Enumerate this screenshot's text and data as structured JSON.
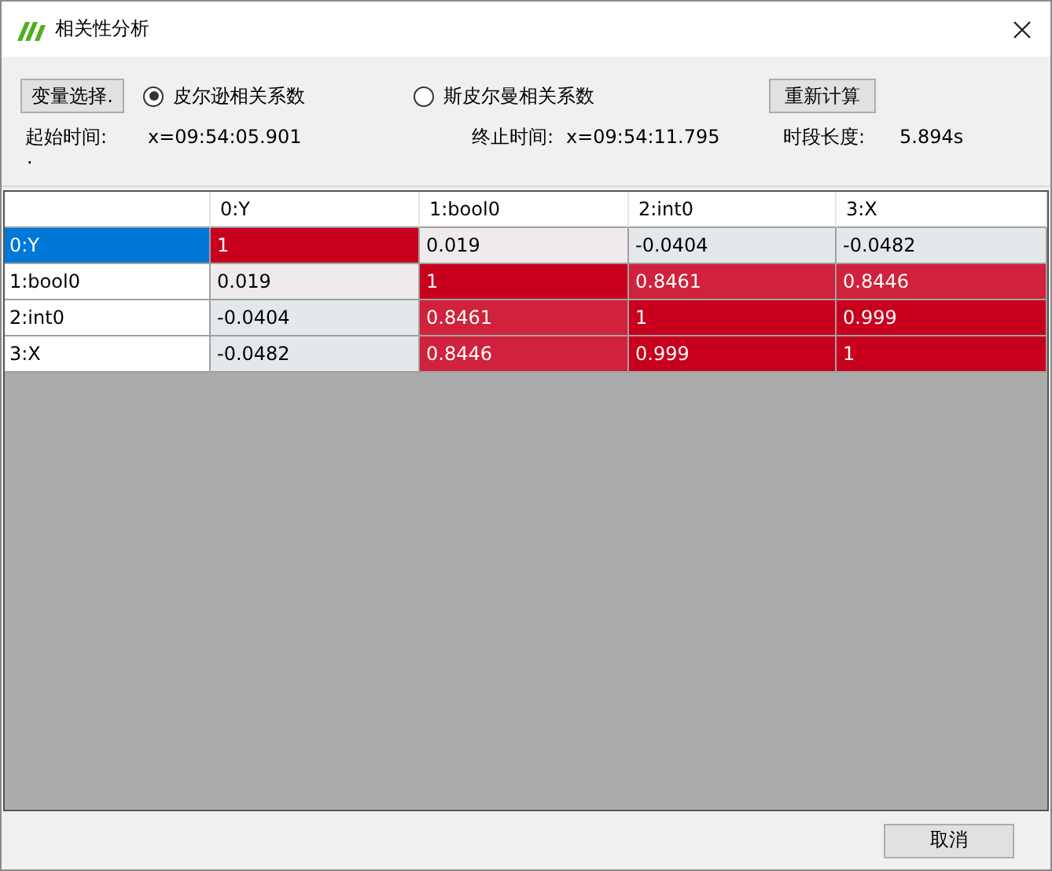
{
  "window": {
    "title": "相关性分析"
  },
  "toolbar": {
    "select_button": "变量选择.",
    "methods": [
      {
        "label": "皮尔逊相关系数",
        "selected": true
      },
      {
        "label": "斯皮尔曼相关系数",
        "selected": false
      }
    ],
    "recalc_button": "重新计算"
  },
  "info": [
    {
      "label": "起始时间:",
      "value": "x=09:54:05.901"
    },
    {
      "label": "终止时间:",
      "value": "x=09:54:11.795"
    },
    {
      "label": "时段长度:",
      "value": "5.894s"
    }
  ],
  "note": ".",
  "table": {
    "columns": [
      "0:Y",
      "1:bool0",
      "2:int0",
      "3:X"
    ],
    "rows": [
      {
        "header": "0:Y",
        "selected": true,
        "cells": [
          {
            "text": "1",
            "color": "#c8001e"
          },
          {
            "text": "0.019",
            "color": "#efebec"
          },
          {
            "text": "-0.0404",
            "color": "#e5e8eb"
          },
          {
            "text": "-0.0482",
            "color": "#e5e8eb"
          }
        ]
      },
      {
        "header": "1:bool0",
        "selected": false,
        "cells": [
          {
            "text": "0.019",
            "color": "#efebec"
          },
          {
            "text": "1",
            "color": "#c8001e"
          },
          {
            "text": "0.8461",
            "color": "#d0223c"
          },
          {
            "text": "0.8446",
            "color": "#d0223c"
          }
        ]
      },
      {
        "header": "2:int0",
        "selected": false,
        "cells": [
          {
            "text": "-0.0404",
            "color": "#e5e8eb"
          },
          {
            "text": "0.8461",
            "color": "#d0223c"
          },
          {
            "text": "1",
            "color": "#c8001e"
          },
          {
            "text": "0.999",
            "color": "#c8001e"
          }
        ]
      },
      {
        "header": "3:X",
        "selected": false,
        "cells": [
          {
            "text": "-0.0482",
            "color": "#e5e8eb"
          },
          {
            "text": "0.8446",
            "color": "#d0223c"
          },
          {
            "text": "0.999",
            "color": "#c8001e"
          },
          {
            "text": "1",
            "color": "#c8001e"
          }
        ]
      }
    ]
  },
  "buttons": [
    "取消"
  ]
}
